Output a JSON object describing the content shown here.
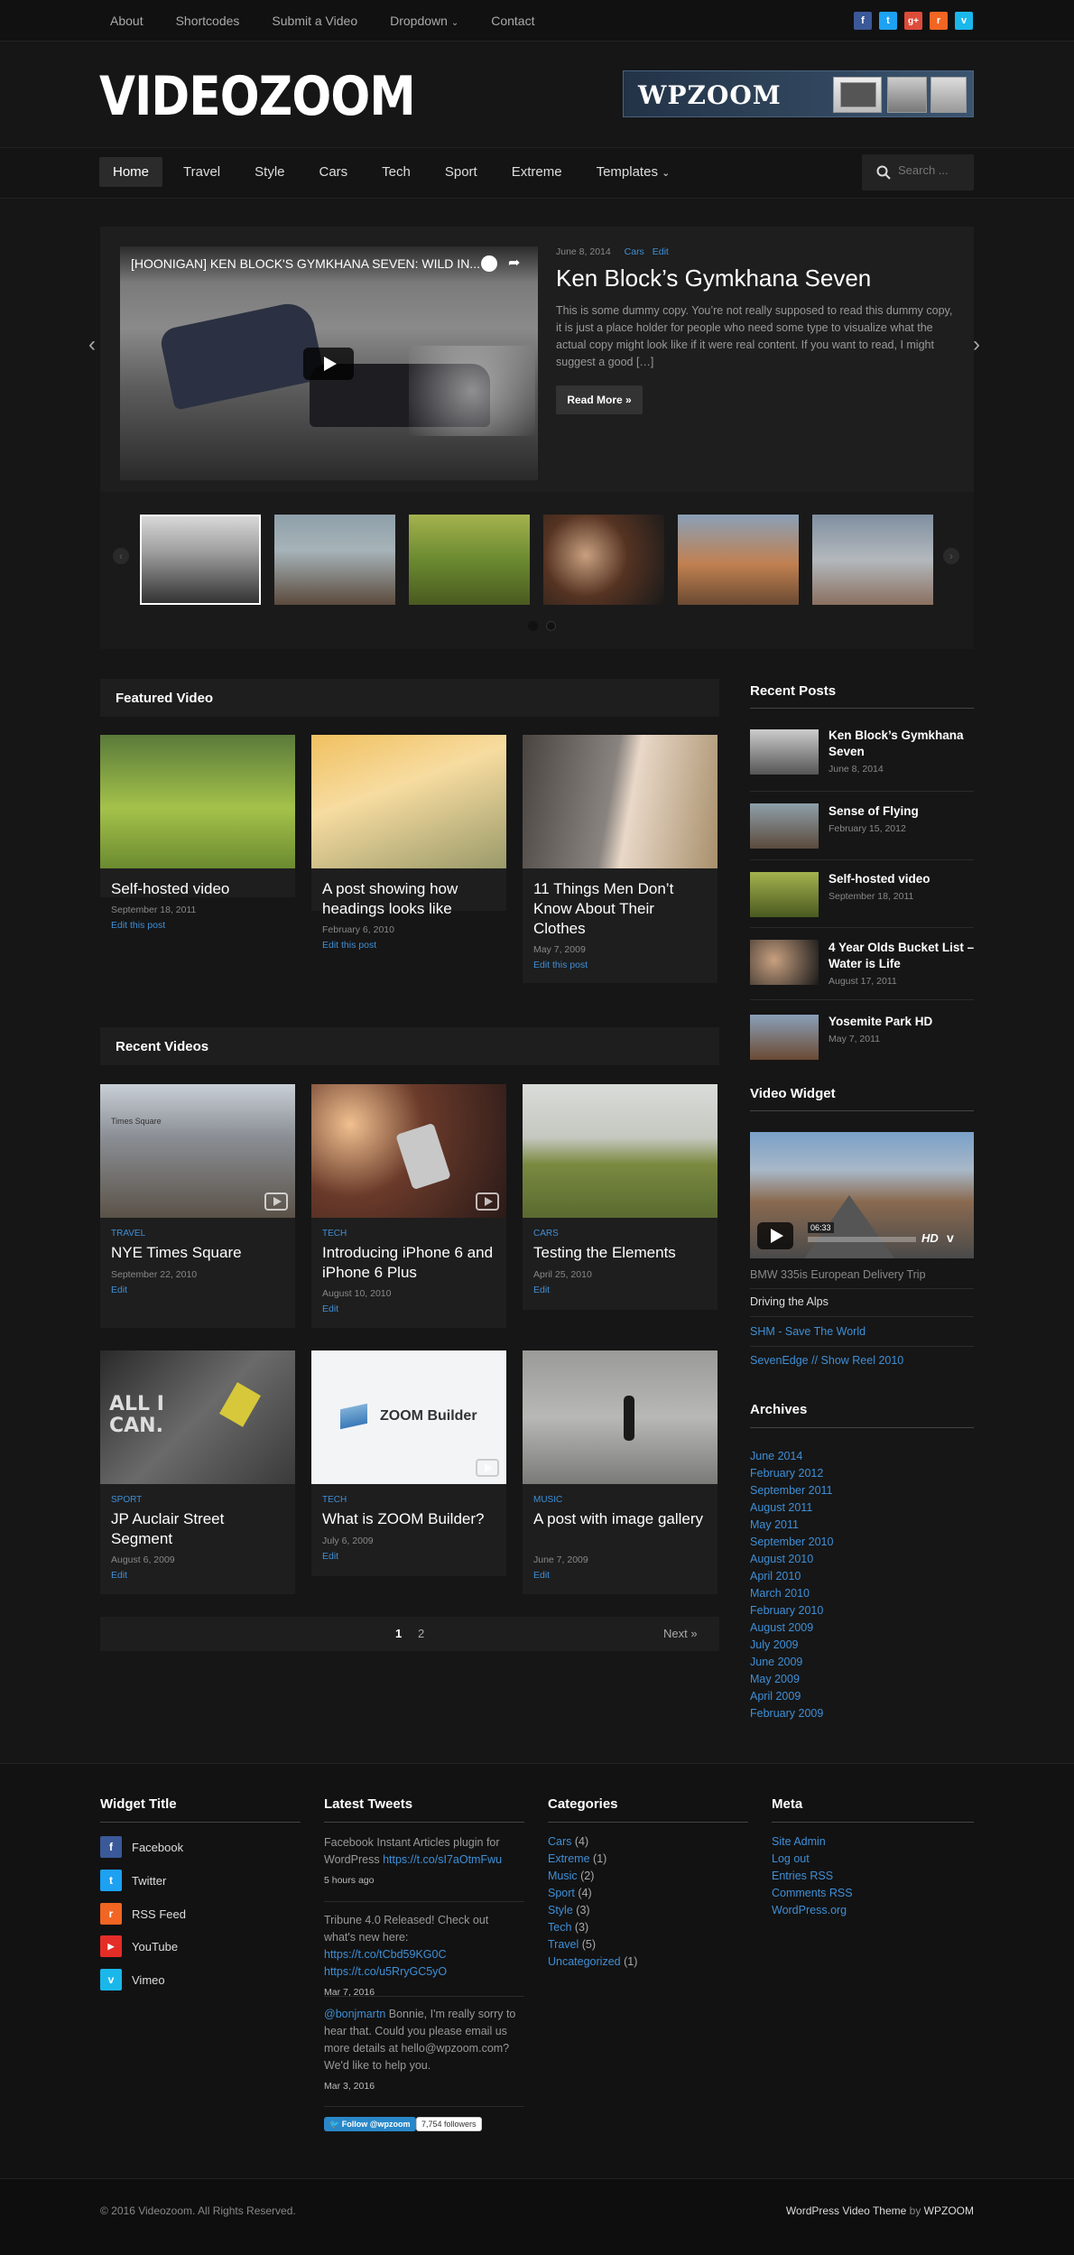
{
  "topnav": {
    "items": [
      "About",
      "Shortcodes",
      "Submit a Video",
      "Dropdown",
      "Contact"
    ]
  },
  "social_icons": [
    {
      "name": "facebook-icon",
      "glyph": "f",
      "color": "#3b5998"
    },
    {
      "name": "twitter-icon",
      "glyph": "t",
      "color": "#1da1f2"
    },
    {
      "name": "google-plus-icon",
      "glyph": "g+",
      "color": "#dd4b39"
    },
    {
      "name": "rss-icon",
      "glyph": "r",
      "color": "#f26522"
    },
    {
      "name": "vimeo-icon",
      "glyph": "v",
      "color": "#1ab7ea"
    }
  ],
  "site": {
    "logo": "VIDEOZOOM",
    "banner_text": "WPZOOM"
  },
  "mainnav": {
    "items": [
      "Home",
      "Travel",
      "Style",
      "Cars",
      "Tech",
      "Sport",
      "Extreme",
      "Templates"
    ],
    "active": "Home"
  },
  "search": {
    "placeholder": "Search ..."
  },
  "slider": {
    "video_title": "[HOONIGAN] KEN BLOCK'S GYMKHANA SEVEN: WILD IN...",
    "date": "June 8, 2014",
    "category": "Cars",
    "edit": "Edit",
    "title": "Ken Block’s Gymkhana Seven",
    "excerpt": "This is some dummy copy. You’re not really supposed to read this dummy copy, it is just a place holder for people who need some type to visualize what the actual copy might look like if it were real content. If you want to read, I might suggest a good […]",
    "read_more": "Read More »"
  },
  "featured": {
    "heading": "Featured Video",
    "posts": [
      {
        "title": "Self-hosted video",
        "date": "September 18, 2011",
        "edit": "Edit this post"
      },
      {
        "title": "A post showing how headings looks like",
        "date": "February 6, 2010",
        "edit": "Edit this post"
      },
      {
        "title": "11 Things Men Don’t Know About Their Clothes",
        "date": "May 7, 2009",
        "edit": "Edit this post"
      }
    ]
  },
  "recent_videos": {
    "heading": "Recent Videos",
    "posts": [
      {
        "cat": "Travel",
        "title": "NYE Times Square",
        "date": "September 22, 2010",
        "edit": "Edit",
        "img_text": "Times Square"
      },
      {
        "cat": "Tech",
        "title": "Introducing iPhone 6 and iPhone 6 Plus",
        "date": "August 10, 2010",
        "edit": "Edit"
      },
      {
        "cat": "Cars",
        "title": "Testing the Elements",
        "date": "April 25, 2010",
        "edit": "Edit"
      },
      {
        "cat": "Sport",
        "title": "JP Auclair Street Segment",
        "date": "August 6, 2009",
        "edit": "Edit",
        "img_text": "ALL I CAN."
      },
      {
        "cat": "Tech",
        "title": "What is ZOOM Builder?",
        "date": "July 6, 2009",
        "edit": "Edit",
        "img_text": "ZOOM Builder"
      },
      {
        "cat": "Music",
        "title": "A post with image gallery",
        "date": "June 7, 2009",
        "edit": "Edit"
      }
    ]
  },
  "pagination": {
    "pages": [
      "1",
      "2"
    ],
    "next": "Next »"
  },
  "sidebar": {
    "recent_posts": {
      "title": "Recent Posts",
      "items": [
        {
          "title": "Ken Block’s Gymkhana Seven",
          "date": "June 8, 2014"
        },
        {
          "title": "Sense of Flying",
          "date": "February 15, 2012"
        },
        {
          "title": "Self-hosted video",
          "date": "September 18, 2011"
        },
        {
          "title": "4 Year Olds Bucket List – Water is Life",
          "date": "August 17, 2011"
        },
        {
          "title": "Yosemite Park HD",
          "date": "May 7, 2011"
        }
      ]
    },
    "video_widget": {
      "title": "Video Widget",
      "time": "06:33",
      "caption": "BMW 335is European Delivery Trip",
      "links": [
        "Driving the Alps",
        "SHM - Save The World",
        "SevenEdge // Show Reel 2010"
      ]
    },
    "archives": {
      "title": "Archives",
      "items": [
        "June 2014",
        "February 2012",
        "September 2011",
        "August 2011",
        "May 2011",
        "September 2010",
        "August 2010",
        "April 2010",
        "March 2010",
        "February 2010",
        "August 2009",
        "July 2009",
        "June 2009",
        "May 2009",
        "April 2009",
        "February 2009"
      ]
    }
  },
  "footer": {
    "widget": {
      "title": "Widget Title",
      "items": [
        {
          "label": "Facebook",
          "glyph": "f",
          "color": "#3b5998",
          "icon": "facebook-icon"
        },
        {
          "label": "Twitter",
          "glyph": "t",
          "color": "#1da1f2",
          "icon": "twitter-icon"
        },
        {
          "label": "RSS Feed",
          "glyph": "r",
          "color": "#f26522",
          "icon": "rss-icon"
        },
        {
          "label": "YouTube",
          "glyph": "▶",
          "color": "#e52d27",
          "icon": "youtube-icon"
        },
        {
          "label": "Vimeo",
          "glyph": "v",
          "color": "#1ab7ea",
          "icon": "vimeo-icon"
        }
      ]
    },
    "tweets": {
      "title": "Latest Tweets",
      "items": [
        {
          "pre": "Facebook Instant Articles plugin for WordPress ",
          "link": "https://t.co/sI7aOtmFwu",
          "post": "",
          "time": "5 hours ago"
        },
        {
          "pre": "Tribune 4.0 Released! Check out what's new here: ",
          "link": "https://t.co/tCbd59KG0C https://t.co/u5RryGC5yO",
          "post": "",
          "time": "Mar 7, 2016"
        },
        {
          "pre": "",
          "link": "@bonjmartn",
          "post": " Bonnie, I'm really sorry to hear that. Could you please email us more details at hello@wpzoom.com? We'd like to help you.",
          "time": "Mar 3, 2016"
        }
      ],
      "follow": "Follow @wpzoom",
      "followers": "7,754 followers"
    },
    "categories": {
      "title": "Categories",
      "items": [
        {
          "name": "Cars",
          "count": "(4)"
        },
        {
          "name": "Extreme",
          "count": "(1)"
        },
        {
          "name": "Music",
          "count": "(2)"
        },
        {
          "name": "Sport",
          "count": "(4)"
        },
        {
          "name": "Style",
          "count": "(3)"
        },
        {
          "name": "Tech",
          "count": "(3)"
        },
        {
          "name": "Travel",
          "count": "(5)"
        },
        {
          "name": "Uncategorized",
          "count": "(1)"
        }
      ]
    },
    "meta": {
      "title": "Meta",
      "items": [
        "Site Admin",
        "Log out",
        "Entries RSS",
        "Comments RSS",
        "WordPress.org"
      ]
    }
  },
  "bottom": {
    "copyright": "© 2016 Videozoom. All Rights Reserved.",
    "credit_pre": "WordPress Video Theme",
    "credit_by": " by ",
    "credit_brand": "WPZOOM"
  }
}
